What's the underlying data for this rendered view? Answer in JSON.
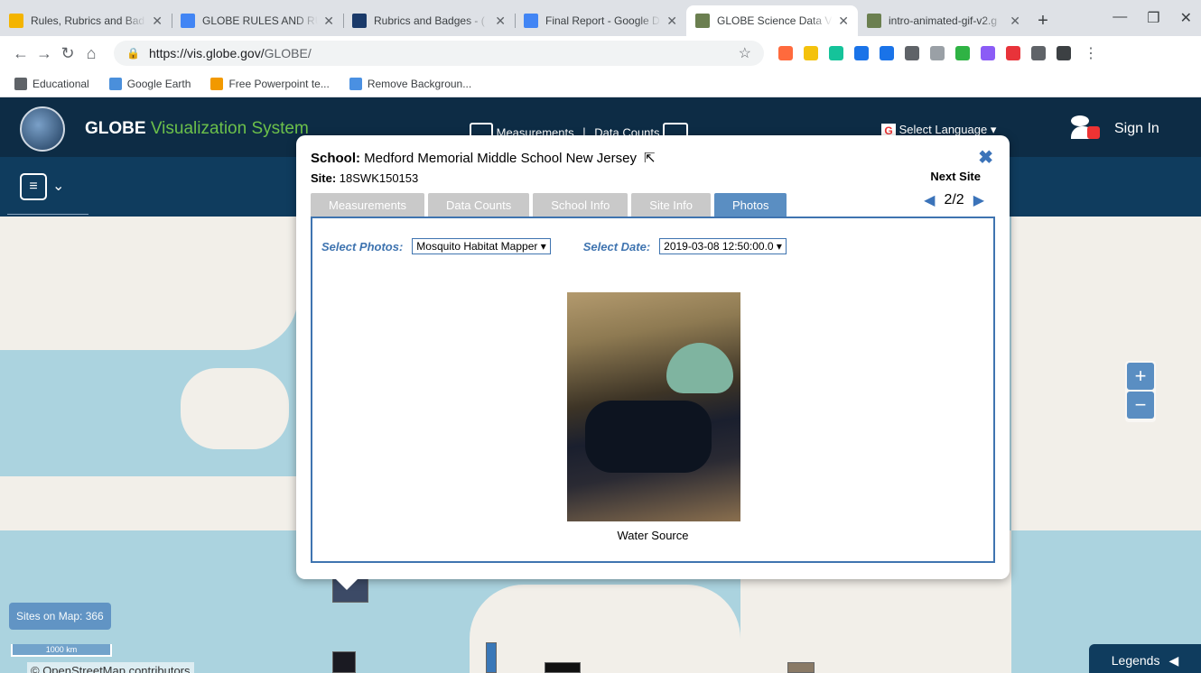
{
  "browser": {
    "tabs": [
      {
        "title": "Rules, Rubrics and Bad",
        "favicon": "drive-icon",
        "color": "#f4b400",
        "active": false
      },
      {
        "title": "GLOBE RULES AND RU",
        "favicon": "docs-icon",
        "color": "#4285f4",
        "active": false
      },
      {
        "title": "Rubrics and Badges - (",
        "favicon": "globe-icon",
        "color": "#1a3a6a",
        "active": false
      },
      {
        "title": "Final Report - Google D",
        "favicon": "docs-icon",
        "color": "#4285f4",
        "active": false
      },
      {
        "title": "GLOBE Science Data V",
        "favicon": "image-icon",
        "color": "#6b7f50",
        "active": true
      },
      {
        "title": "intro-animated-gif-v2.g",
        "favicon": "image-icon",
        "color": "#6b7f50",
        "active": false
      }
    ],
    "url_host": "https://vis.globe.gov/",
    "url_path": "GLOBE/",
    "bookmarks": [
      {
        "label": "Educational",
        "color": "#5f6368"
      },
      {
        "label": "Google Earth",
        "color": "#4a8fdb"
      },
      {
        "label": "Free Powerpoint te...",
        "color": "#f29900"
      },
      {
        "label": "Remove Backgroun...",
        "color": "#4a90e2"
      }
    ],
    "extension_colors": [
      "#ff6a3d",
      "#f4c20d",
      "#15c39a",
      "#1a73e8",
      "#1a73e8",
      "#5f6368",
      "#9aa0a6",
      "#2fb344",
      "#8b5cf6",
      "#e8333a",
      "#5f6368",
      "#3c4043"
    ]
  },
  "app": {
    "brand_main": "GLOBE",
    "brand_sub": "Visualization System",
    "header_measurements": "Measurements",
    "header_datacounts": "Data Counts",
    "select_language": "Select Language",
    "sign_in": "Sign In",
    "sites_on_map": "Sites on Map: 366",
    "scale_label": "1000 km",
    "attribution": "© OpenStreetMap contributors",
    "legends": "Legends",
    "zoom_in": "+",
    "zoom_out": "−"
  },
  "dialog": {
    "school_label": "School:",
    "school_name": "Medford Memorial Middle School New Jersey",
    "site_label": "Site:",
    "site_id": "18SWK150153",
    "next_site": "Next Site",
    "pager": "2/2",
    "tabs": [
      "Measurements",
      "Data Counts",
      "School Info",
      "Site Info",
      "Photos"
    ],
    "active_tab": "Photos",
    "select_photos_label": "Select Photos:",
    "select_photos_value": "Mosquito Habitat Mapper",
    "select_date_label": "Select Date:",
    "select_date_value": "2019-03-08 12:50:00.0",
    "photo_caption": "Water Source"
  }
}
